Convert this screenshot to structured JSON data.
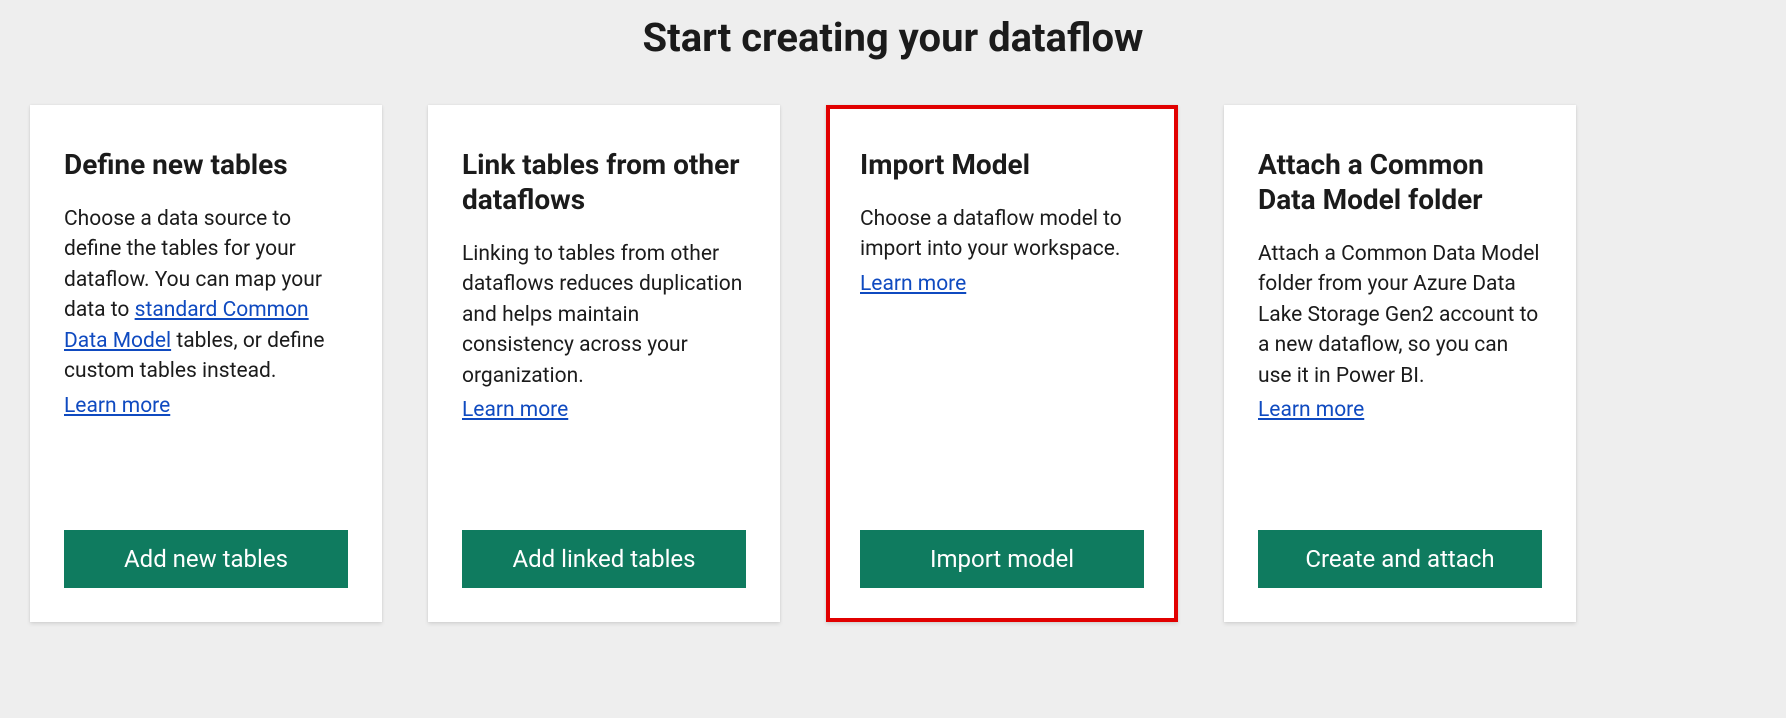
{
  "page_title": "Start creating your dataflow",
  "cards": [
    {
      "title": "Define new tables",
      "desc_before_link": "Choose a data source to define the tables for your dataflow. You can map your data to ",
      "inline_link": "standard Common Data Model",
      "desc_after_link": " tables, or define custom tables instead.",
      "learn_more": "Learn more",
      "button": "Add new tables",
      "highlighted": false
    },
    {
      "title": "Link tables from other dataflows",
      "desc_before_link": "Linking to tables from other dataflows reduces duplication and helps maintain consistency across your organization.",
      "inline_link": "",
      "desc_after_link": "",
      "learn_more": "Learn more",
      "button": "Add linked tables",
      "highlighted": false
    },
    {
      "title": "Import Model",
      "desc_before_link": "Choose a dataflow model to import into your workspace.",
      "inline_link": "",
      "desc_after_link": "",
      "learn_more": "Learn more",
      "button": "Import model",
      "highlighted": true
    },
    {
      "title": "Attach a Common Data Model folder",
      "desc_before_link": "Attach a Common Data Model folder from your Azure Data Lake Storage Gen2 account to a new dataflow, so you can use it in Power BI.",
      "inline_link": "",
      "desc_after_link": "",
      "learn_more": "Learn more",
      "button": "Create and attach",
      "highlighted": false
    }
  ]
}
